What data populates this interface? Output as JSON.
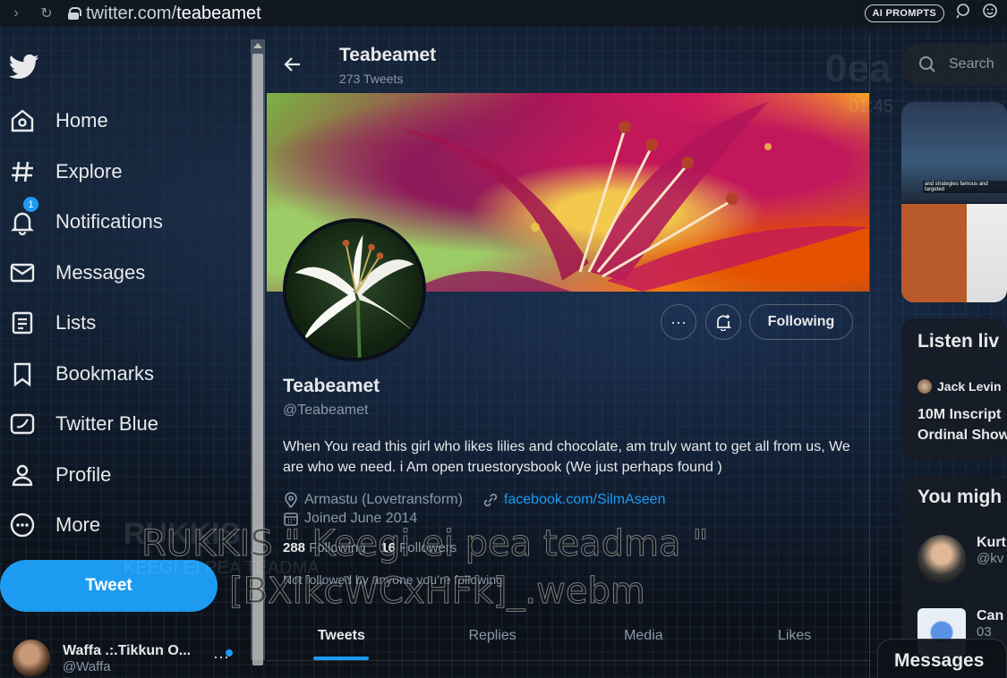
{
  "browser": {
    "url_prefix": "twitter.com/",
    "url_path": "teabeamet",
    "ai_prompts": "AI PROMPTS"
  },
  "sidebar": {
    "items": [
      {
        "label": "Home",
        "icon": "home-icon"
      },
      {
        "label": "Explore",
        "icon": "hashtag-icon"
      },
      {
        "label": "Notifications",
        "icon": "bell-icon",
        "badge": "1"
      },
      {
        "label": "Messages",
        "icon": "envelope-icon"
      },
      {
        "label": "Lists",
        "icon": "list-icon"
      },
      {
        "label": "Bookmarks",
        "icon": "bookmark-icon"
      },
      {
        "label": "Twitter Blue",
        "icon": "twitter-blue-icon"
      },
      {
        "label": "Profile",
        "icon": "person-icon"
      },
      {
        "label": "More",
        "icon": "more-circle-icon"
      }
    ],
    "tweet_button": "Tweet",
    "account": {
      "name": "Waffa .:.Tikkun O...",
      "handle": "@Waffa"
    }
  },
  "header": {
    "name": "Teabeamet",
    "tweet_count": "273 Tweets"
  },
  "profile": {
    "name": "Teabeamet",
    "handle": "@Teabeamet",
    "bio": "When You read this girl who likes lilies and chocolate, am truly want to get all from us, We are who we need. i Am open truestorysbook (We just perhaps found )",
    "location": "Armastu (Lovetransform)",
    "website": "facebook.com/SilmAseen",
    "joined": "Joined June 2014",
    "following_count": "288",
    "following_label": "Following",
    "followers_count": "16",
    "followers_label": "Followers",
    "not_followed": "Not followed by anyone you’re following",
    "following_button": "Following"
  },
  "tabs": [
    "Tweets",
    "Replies",
    "Media",
    "Likes"
  ],
  "overlay": {
    "caption_line1": "RUKKIS \" Keegi ei pea teadma \"",
    "caption_line2": "[BXIkcWCxHFk]_.webm",
    "ghost_title": "RUKKIS",
    "ghost_sub": "KEEGI EI PEA TEADMA"
  },
  "right": {
    "search_placeholder": "Search",
    "watermark": "0ea",
    "time_ghost": "01:45",
    "media_caption": "and strategies famous and targeted",
    "listen_title": "Listen liv",
    "listen_host": "Jack Levin",
    "listen_space": [
      "10M Inscript",
      "Ordinal Show"
    ],
    "wtf_title": "You migh",
    "wtf_users": [
      {
        "name": "Kurt",
        "handle": "@kv"
      },
      {
        "name": "Can",
        "handle": "03"
      }
    ],
    "messages_dock": "Messages"
  },
  "colors": {
    "accent": "#1d9bf0",
    "text": "#e7e9ea",
    "muted": "#8b98a5"
  }
}
